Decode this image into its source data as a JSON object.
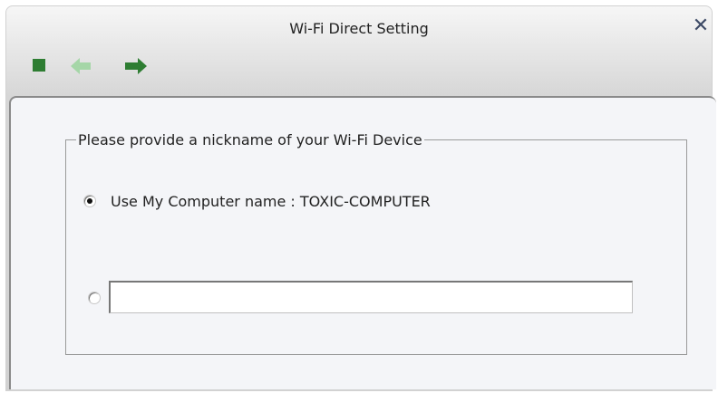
{
  "window": {
    "title": "Wi-Fi Direct Setting",
    "close_symbol": "✕"
  },
  "toolbar": {
    "icons": [
      "stop-icon",
      "back-arrow-icon",
      "forward-arrow-icon"
    ],
    "icon_colors": {
      "stop": "#2e7d32",
      "back_disabled": "#a5d6a7",
      "forward": "#2e7d32"
    }
  },
  "group": {
    "legend": "Please provide a nickname of your Wi-Fi Device"
  },
  "options": {
    "computer_name_label": "Use My Computer name : TOXIC-COMPUTER",
    "computer_name_selected": true,
    "custom_selected": false,
    "custom_value": "",
    "custom_placeholder": ""
  }
}
